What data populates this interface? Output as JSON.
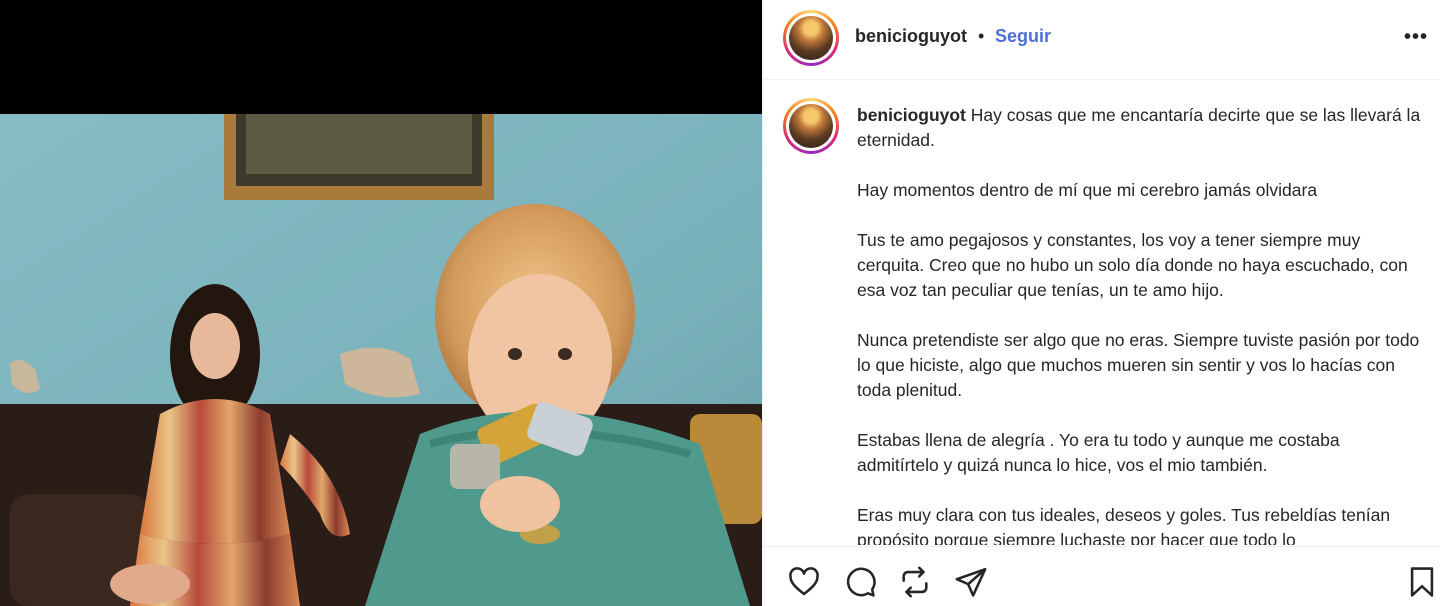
{
  "post": {
    "username": "benicioguyot",
    "separator": "•",
    "follow_label": "Seguir",
    "more_label": "•••",
    "caption_paragraphs": [
      "Hay cosas que me encantaría decirte que se las llevará la eternidad.",
      "Hay momentos dentro de mí que mi cerebro jamás olvidara",
      "Tus te amo pegajosos y constantes, los voy a tener siempre muy cerquita. Creo que no hubo un solo día donde no haya escuchado, con esa voz tan peculiar que tenías, un te amo hijo.",
      "Nunca pretendiste ser algo que no eras. Siempre tuviste pasión por todo lo que hiciste, algo que muchos mueren sin sentir y vos lo hacías con toda plenitud.",
      "Estabas llena de alegría . Yo era tu todo y aunque me costaba admitírtelo y quizá nunca lo hice, vos el mio también.",
      "Eras muy clara con tus ideales, deseos y goles. Tus rebeldías tenían propósito porque siempre luchaste por hacer que todo lo"
    ]
  },
  "actions": {
    "like_icon": "heart-icon",
    "comment_icon": "comment-icon",
    "repost_icon": "repost-icon",
    "share_icon": "share-icon",
    "save_icon": "bookmark-icon"
  },
  "colors": {
    "follow": "#4f6fd8",
    "text": "#262626",
    "border": "#efefef"
  }
}
